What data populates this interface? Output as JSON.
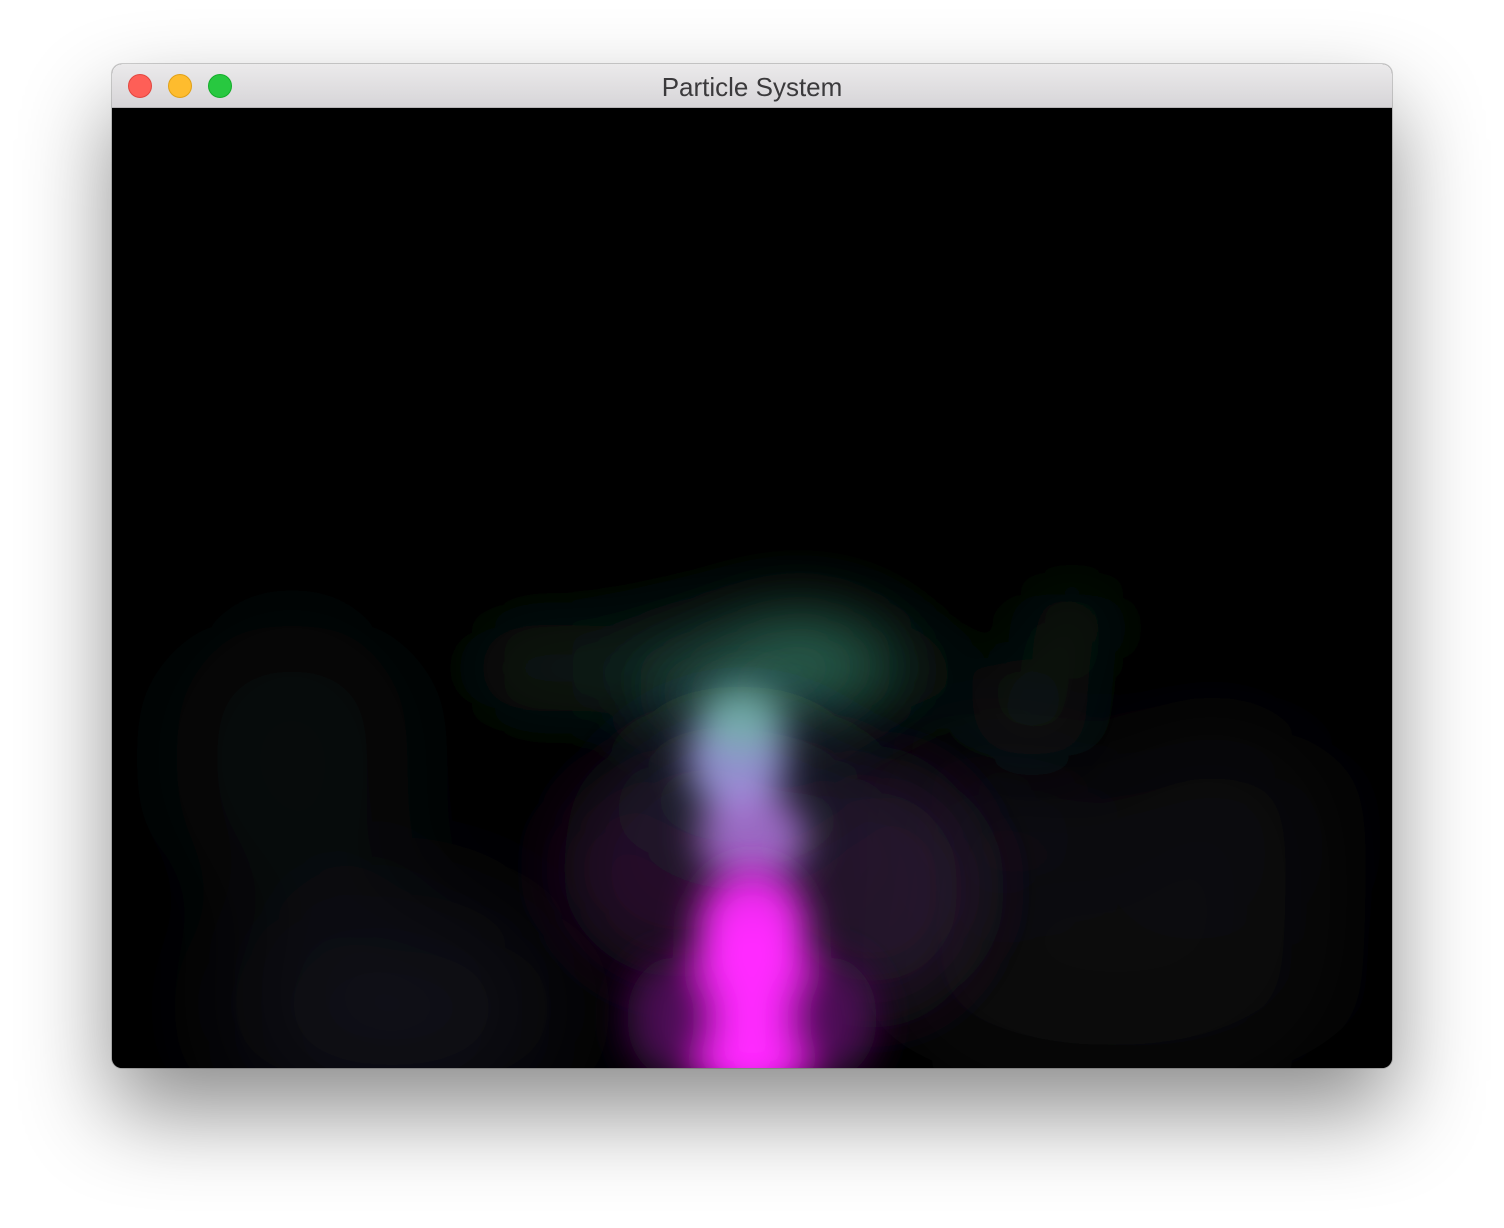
{
  "window": {
    "title": "Particle System"
  },
  "controls": {
    "close": "close-button",
    "minimize": "minimize-button",
    "zoom": "zoom-button"
  },
  "scene": {
    "background": "#000000",
    "colors": {
      "top": "#3f9a78",
      "middle": "#b0a6ee",
      "bottom": "#ff1fff"
    }
  }
}
